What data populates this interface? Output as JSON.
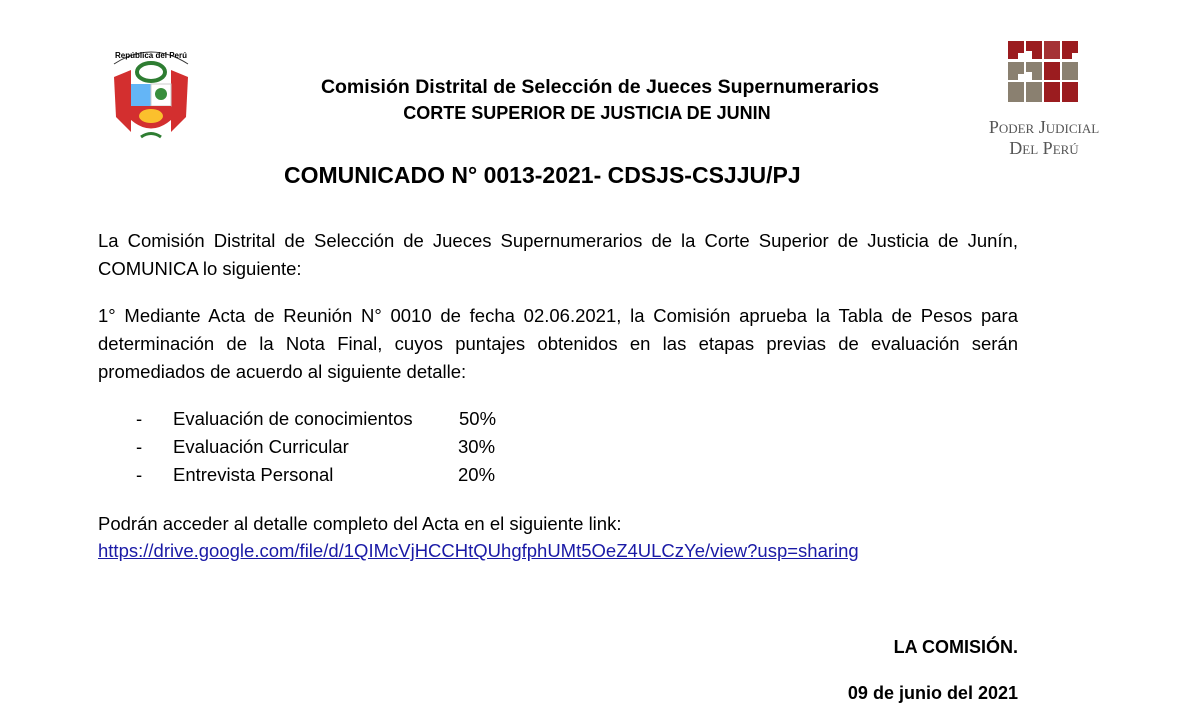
{
  "header": {
    "emblem_text": "República del Perú",
    "line1": "Comisión Distrital de Selección de Jueces Supernumerarios",
    "line2": "CORTE SUPERIOR DE JUSTICIA DE JUNIN",
    "logo_text1": "Poder Judicial",
    "logo_text2": "Del Perú",
    "logo_colors": {
      "red": "#9b1c1f",
      "gray": "#8a8070"
    }
  },
  "title": "COMUNICADO N° 0013-2021- CDSJS-CSJJU/PJ",
  "intro": "La Comisión Distrital de Selección de Jueces Supernumerarios de la Corte Superior de Justicia de Junín, COMUNICA lo siguiente:",
  "point1": "1°  Mediante Acta de Reunión N° 0010 de fecha 02.06.2021, la Comisión aprueba la Tabla de Pesos para determinación de la Nota Final,  cuyos  puntajes obtenidos en las etapas previas de evaluación serán promediados de acuerdo al siguiente detalle:",
  "items": [
    {
      "bullet": "-",
      "label": "Evaluación de conocimientos",
      "weight": "50%"
    },
    {
      "bullet": "-",
      "label": "Evaluación Curricular",
      "weight": "30%"
    },
    {
      "bullet": "-",
      "label": "Entrevista Personal",
      "weight": "20%"
    }
  ],
  "access_text": "Podrán acceder al detalle completo del Acta  en el siguiente link:",
  "link": "https://drive.google.com/file/d/1QIMcVjHCCHtQUhgfphUMt5OeZ4ULCzYe/view?usp=sharing",
  "signature": "LA COMISIÓN.",
  "date": "09 de junio del 2021"
}
